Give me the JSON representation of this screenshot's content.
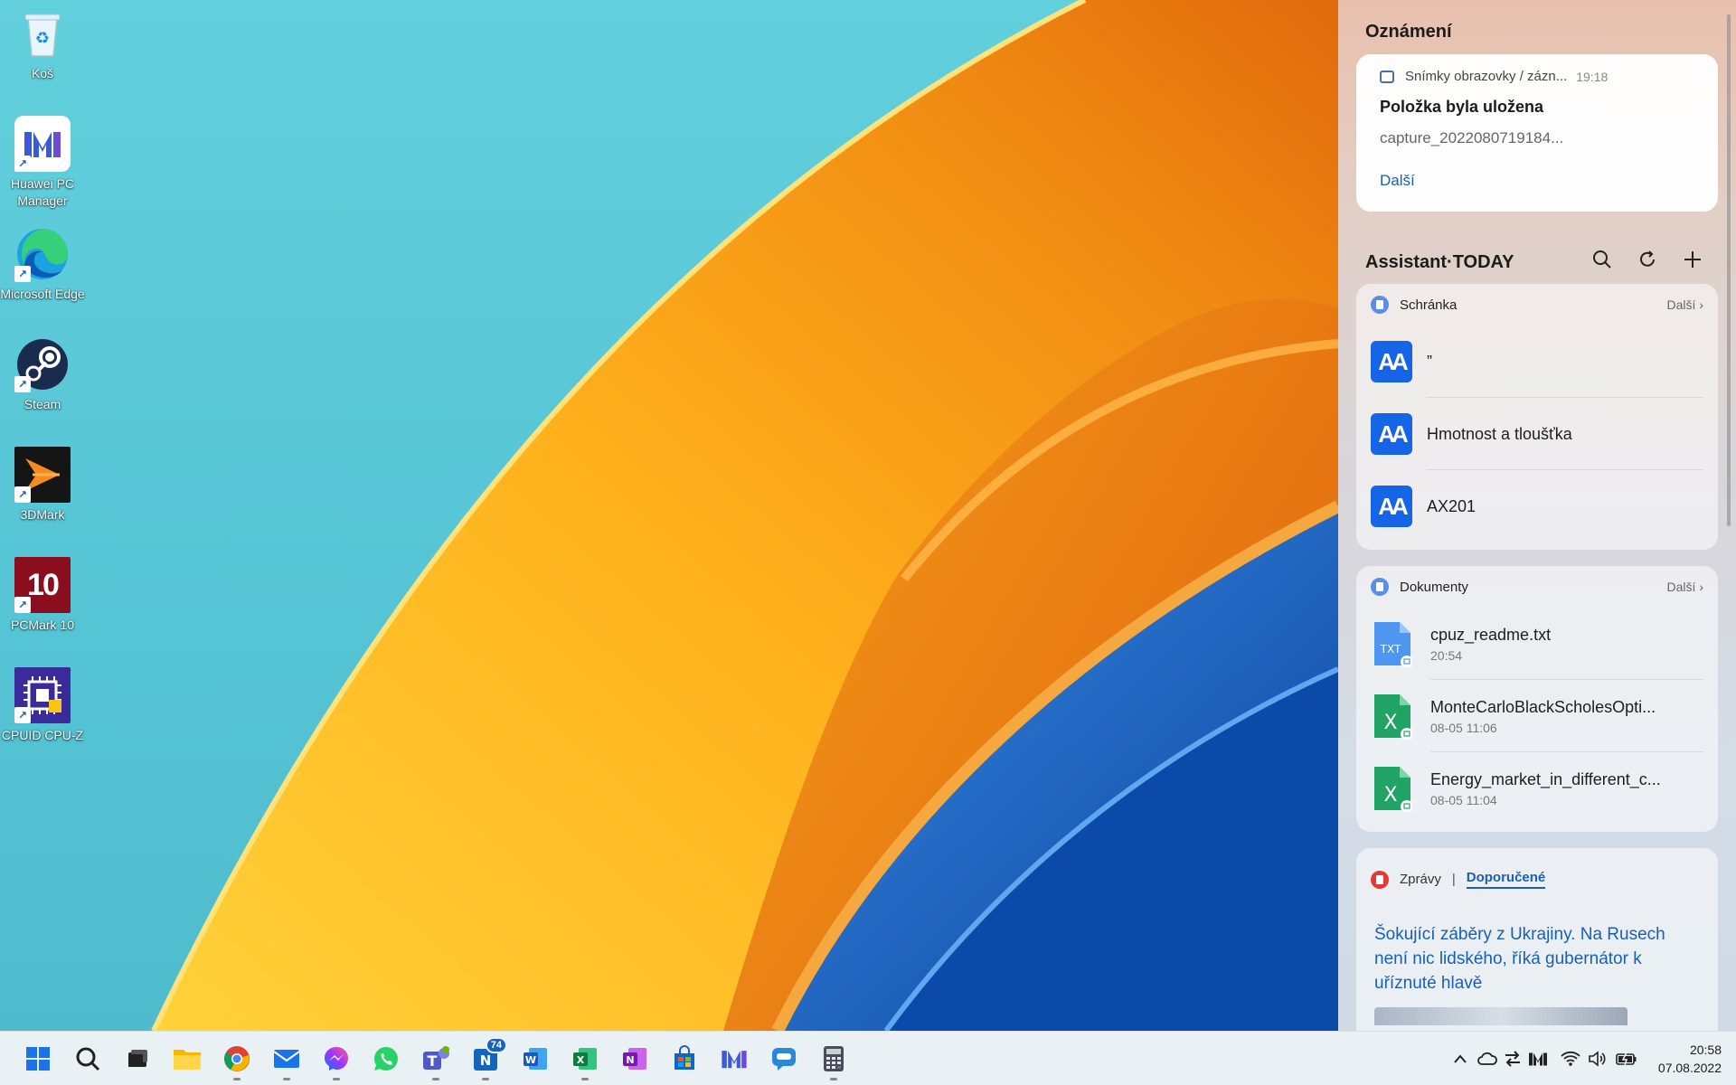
{
  "desktop": {
    "icons": [
      {
        "label": "Koš",
        "icon": "recycle-bin-icon"
      },
      {
        "label": "Huawei PC Manager",
        "icon": "huawei-pc-manager-icon"
      },
      {
        "label": "Microsoft Edge",
        "icon": "edge-icon"
      },
      {
        "label": "Steam",
        "icon": "steam-icon"
      },
      {
        "label": "3DMark",
        "icon": "3dmark-icon"
      },
      {
        "label": "PCMark 10",
        "icon": "pcmark-icon"
      },
      {
        "label": "CPUID CPU-Z",
        "icon": "cpuz-icon"
      }
    ],
    "pcmark_glyph": "10"
  },
  "panel": {
    "notifications_title": "Oznámení",
    "notification": {
      "app": "Snímky obrazovky / zázn...",
      "time": "19:18",
      "title": "Položka byla uložena",
      "body": "capture_2022080719184...",
      "action": "Další"
    },
    "assistant_title": "Assistant·TODAY",
    "clipboard": {
      "title": "Schránka",
      "more": "Další",
      "items": [
        "”",
        "Hmotnost a tloušťka",
        "AX201"
      ]
    },
    "documents": {
      "title": "Dokumenty",
      "more": "Další",
      "items": [
        {
          "name": "cpuz_readme.txt",
          "time": "20:54",
          "type": "TXT"
        },
        {
          "name": "MonteCarloBlackScholesOpti...",
          "time": "08-05 11:06",
          "type": "X"
        },
        {
          "name": "Energy_market_in_different_c...",
          "time": "08-05 11:04",
          "type": "X"
        }
      ]
    },
    "news": {
      "tab_news": "Zprávy",
      "divider": "|",
      "tab_recommended": "Doporučené",
      "headline": "Šokující záběry z Ukrajiny. Na Rusech není nic lidského, říká gubernátor k uříznuté hlavě"
    }
  },
  "taskbar": {
    "apps": [
      "start-icon",
      "search-icon",
      "task-view-icon",
      "file-explorer-icon",
      "chrome-icon",
      "mail-icon",
      "messenger-icon",
      "whatsapp-icon",
      "teams-icon",
      "news-app-icon",
      "word-icon",
      "excel-icon",
      "onenote-icon",
      "store-icon",
      "huawei-pc-manager-icon",
      "feedback-icon",
      "calculator-icon"
    ],
    "news_badge": "74",
    "clock_time": "20:58",
    "clock_date": "07.08.2022"
  },
  "colors": {
    "accent_blue": "#1565e6",
    "link_blue": "#1a5fb4",
    "excel_green": "#21a366"
  }
}
